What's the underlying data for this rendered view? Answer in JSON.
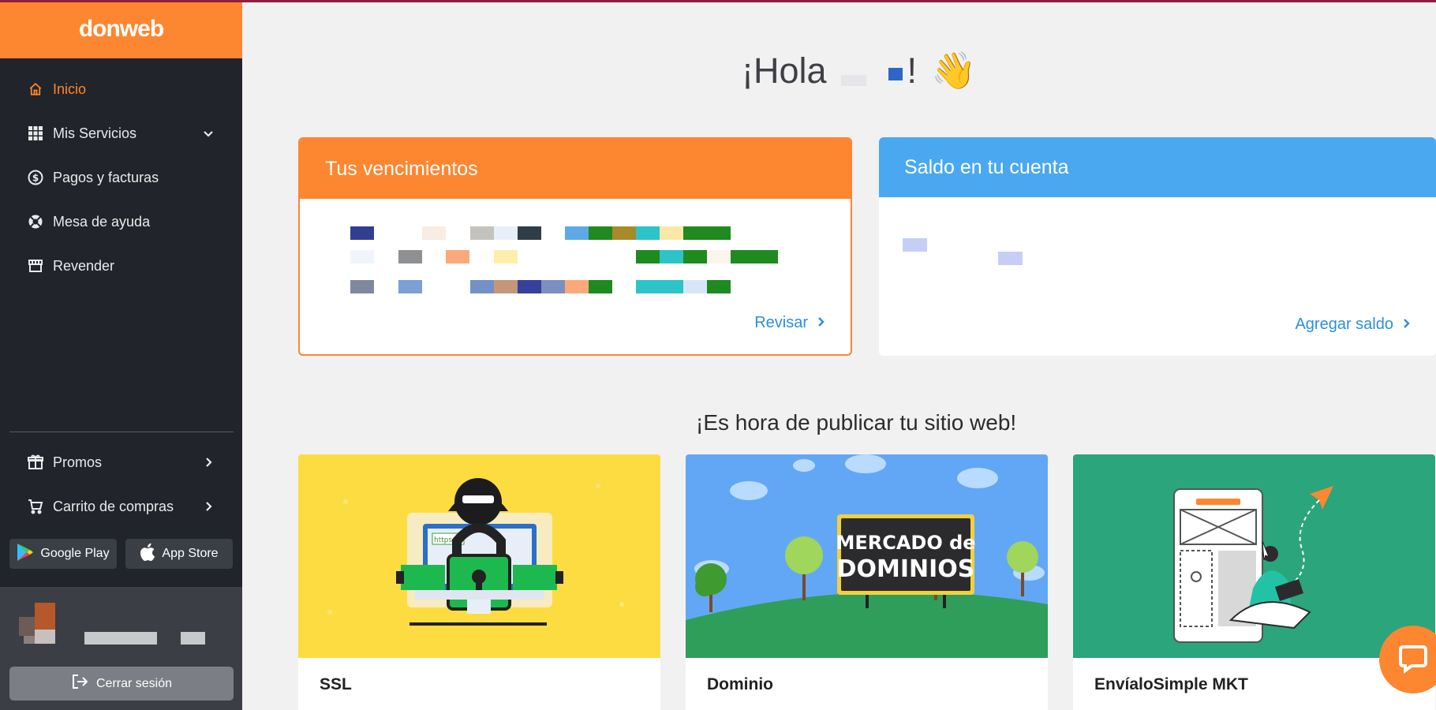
{
  "brand": {
    "logo_text": "donweb",
    "color": "#fd8630"
  },
  "sidebar": {
    "items": [
      {
        "label": "Inicio",
        "icon": "home-icon",
        "active": true
      },
      {
        "label": "Mis Servicios",
        "icon": "grid-icon",
        "has_dropdown": true
      },
      {
        "label": "Pagos y facturas",
        "icon": "dollar-circle-icon"
      },
      {
        "label": "Mesa de ayuda",
        "icon": "lifebuoy-icon"
      },
      {
        "label": "Revender",
        "icon": "store-icon"
      }
    ],
    "lower_items": [
      {
        "label": "Promos",
        "icon": "gift-icon"
      },
      {
        "label": "Carrito de compras",
        "icon": "cart-icon"
      }
    ],
    "stores": {
      "google_play": "Google Play",
      "app_store": "App Store"
    },
    "logout_label": "Cerrar sesión"
  },
  "greeting": {
    "text": "¡Hola",
    "exclaim": "!",
    "emoji": "👋"
  },
  "cards": {
    "vencimientos": {
      "title": "Tus vencimientos",
      "link": "Revisar"
    },
    "saldo": {
      "title": "Saldo en tu cuenta",
      "link": "Agregar saldo"
    }
  },
  "section_title": "¡Es hora de publicar tu sitio web!",
  "promos": [
    {
      "title": "SSL",
      "bg": "#fddc42"
    },
    {
      "title": "Dominio",
      "bg": "#62a7f5",
      "sign_top": "MERCADO de",
      "sign_bottom": "DOMINIOS"
    },
    {
      "title": "EnvíaloSimple MKT",
      "bg": "#2aa57c"
    }
  ],
  "colors": {
    "accent": "#fd8630",
    "blue": "#4aa8f0",
    "link": "#2b8ede",
    "sidebar_bg": "#21242a"
  }
}
